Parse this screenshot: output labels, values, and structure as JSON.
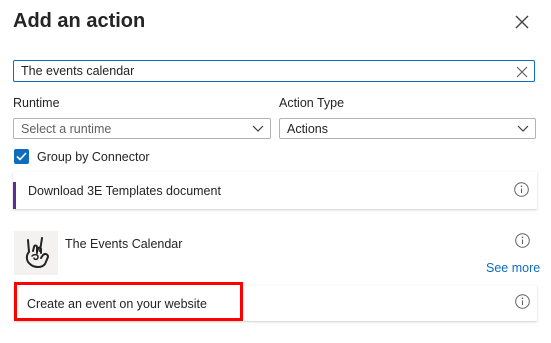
{
  "panel": {
    "title": "Add an action"
  },
  "search": {
    "value": "The events calendar"
  },
  "filters": {
    "runtime_label": "Runtime",
    "runtime_placeholder": "Select a runtime",
    "action_type_label": "Action Type",
    "action_type_value": "Actions"
  },
  "group_by": {
    "label": "Group by Connector",
    "checked": true
  },
  "results": {
    "item1": {
      "label": "Download 3E Templates document"
    },
    "connector": {
      "name": "The Events Calendar",
      "see_more": "See more",
      "action": "Create an event on your website"
    }
  },
  "colors": {
    "accent": "#0f6cbd",
    "card_accent_bar": "#5c2e91",
    "highlight": "#ff0000"
  }
}
